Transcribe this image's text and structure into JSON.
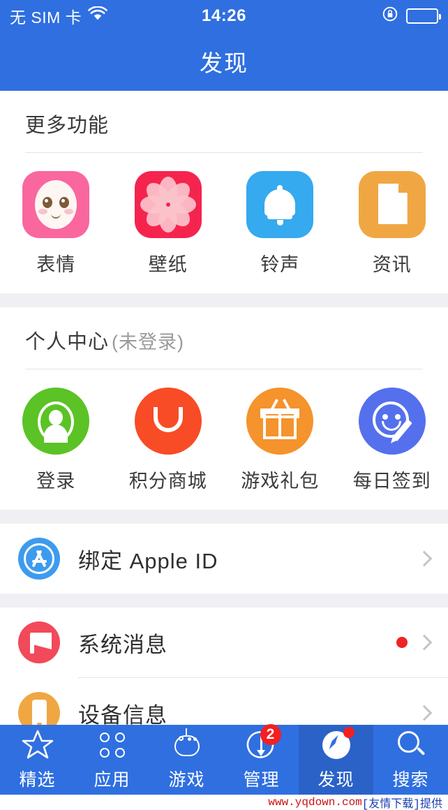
{
  "status_bar": {
    "carrier": "无 SIM 卡",
    "wifi_icon": "wifi-icon",
    "time": "14:26",
    "rotation_lock_icon": "rotation-lock-icon",
    "battery_icon": "battery-icon"
  },
  "nav": {
    "title": "发现"
  },
  "sections": {
    "more_features": {
      "title": "更多功能",
      "items": [
        {
          "label": "表情",
          "icon": "emoji-face-icon",
          "color": "#f9679e"
        },
        {
          "label": "壁纸",
          "icon": "flower-icon",
          "color": "#f5244f"
        },
        {
          "label": "铃声",
          "icon": "bell-icon",
          "color": "#35aaee"
        },
        {
          "label": "资讯",
          "icon": "document-icon",
          "color": "#f0a743"
        }
      ]
    },
    "personal_center": {
      "title": "个人中心",
      "subtitle": "(未登录)",
      "items": [
        {
          "label": "登录",
          "icon": "person-icon",
          "color": "#5bc325"
        },
        {
          "label": "积分商城",
          "icon": "smile-bag-icon",
          "color": "#f84c26"
        },
        {
          "label": "游戏礼包",
          "icon": "gift-icon",
          "color": "#f5932c"
        },
        {
          "label": "每日签到",
          "icon": "smiley-pen-icon",
          "color": "#5570ed"
        }
      ]
    }
  },
  "rows_group_1": [
    {
      "label": "绑定 Apple ID",
      "icon": "app-store-icon",
      "color": "#3d9bee",
      "badge": false
    }
  ],
  "rows_group_2": [
    {
      "label": "系统消息",
      "icon": "megaphone-icon",
      "color": "#f2495b",
      "badge": true
    },
    {
      "label": "设备信息",
      "icon": "phone-icon",
      "color": "#f0a743",
      "badge": false
    }
  ],
  "tabbar": {
    "tabs": [
      {
        "label": "精选",
        "icon": "star-icon",
        "active": false,
        "badge": ""
      },
      {
        "label": "应用",
        "icon": "apps-grid-icon",
        "active": false,
        "badge": ""
      },
      {
        "label": "游戏",
        "icon": "robot-icon",
        "active": false,
        "badge": ""
      },
      {
        "label": "管理",
        "icon": "download-icon",
        "active": false,
        "badge": "2"
      },
      {
        "label": "发现",
        "icon": "compass-icon",
        "active": true,
        "badge": "dot"
      },
      {
        "label": "搜索",
        "icon": "search-icon",
        "active": false,
        "badge": ""
      }
    ]
  },
  "watermark": {
    "url": "www.yqdown.com",
    "suffix": "[友情下载]提供"
  },
  "colors": {
    "brand_blue": "#2f6fe0",
    "active_tab": "#2a62c8",
    "badge_red": "#f32020",
    "page_bg": "#efeff4"
  }
}
